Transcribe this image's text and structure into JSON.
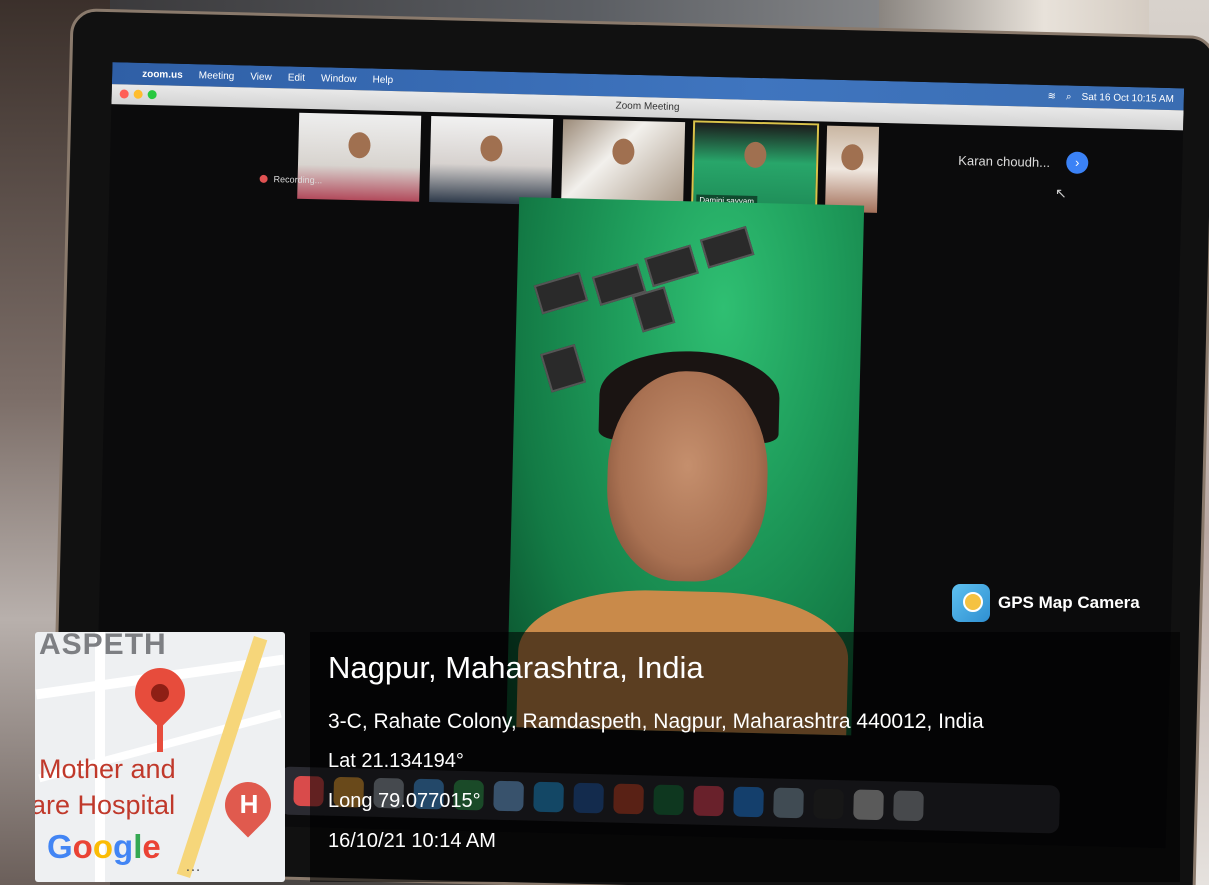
{
  "menubar": {
    "app": "zoom.us",
    "items": [
      "Meeting",
      "View",
      "Edit",
      "Window",
      "Help"
    ],
    "clock": "Sat 16 Oct 10:15 AM"
  },
  "window": {
    "title": "Zoom Meeting"
  },
  "participants": [
    {
      "name": ""
    },
    {
      "name": ""
    },
    {
      "name": ""
    },
    {
      "name": "Damini sayyam",
      "active": true
    },
    {
      "name": ""
    }
  ],
  "more_participant": "Karan choudh...",
  "recording_label": "Recording...",
  "gps_overlay": {
    "brand": "GPS Map Camera",
    "place": "Nagpur, Maharashtra, India",
    "address": "3-C, Rahate Colony, Ramdaspeth, Nagpur, Maharashtra 440012, India",
    "lat": "Lat 21.134194°",
    "long": "Long 79.077015°",
    "datetime": "16/10/21 10:14 AM"
  },
  "map": {
    "street_label": "ASPETH",
    "label_line1": "Mother and",
    "label_line2": "are Hospital",
    "logo": "Google"
  },
  "colors": {
    "menubar": "#3f75bf",
    "green_wall": "#1f9e5c",
    "pin_red": "#e74c3c"
  }
}
